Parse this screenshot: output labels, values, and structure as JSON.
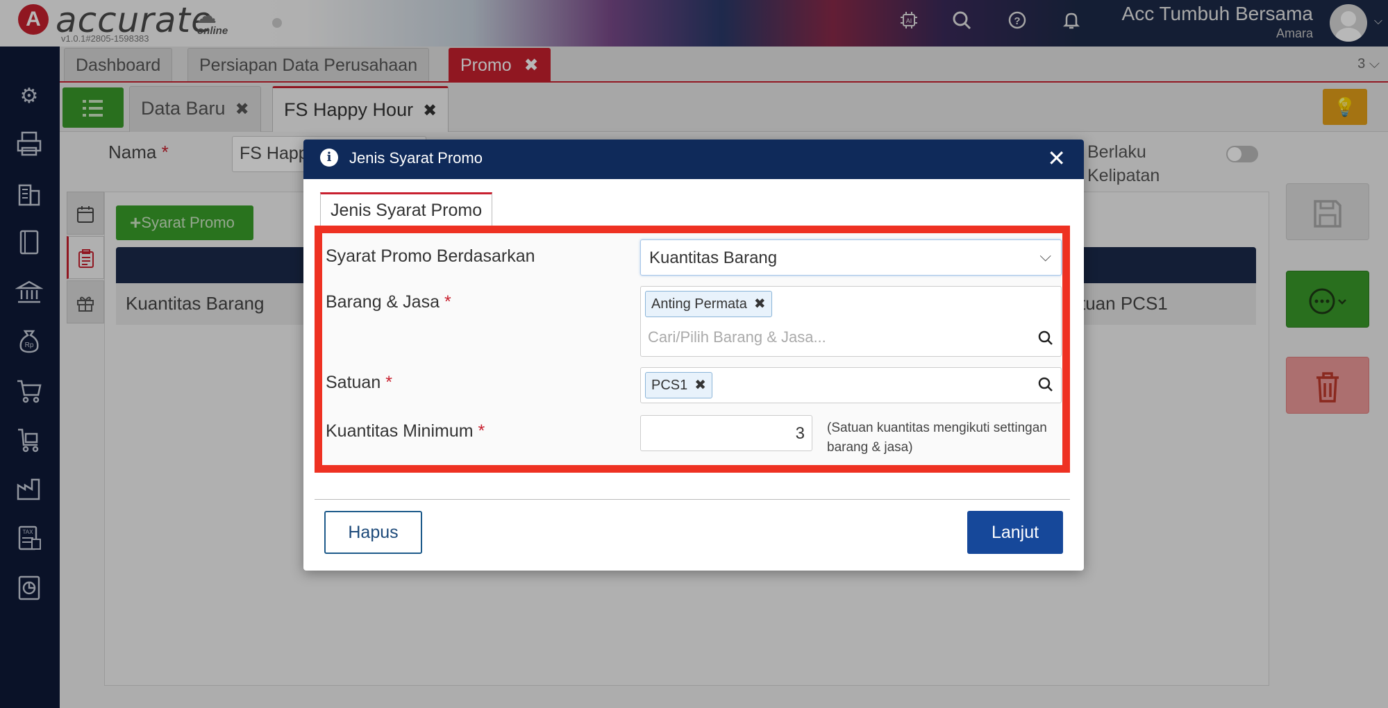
{
  "app": {
    "logo_letter": "A",
    "logo_text": "accurate",
    "logo_sub": "online",
    "version": "v1.0.1#2805-1598383",
    "company_name": "Acc Tumbuh Bersama",
    "user_name": "Amara"
  },
  "top_icons": [
    "ai-chip-icon",
    "search-icon",
    "help-icon",
    "bell-icon"
  ],
  "sidebar": {
    "icons": [
      "gear-icon",
      "printer-icon",
      "building-icon",
      "book-icon",
      "bank-icon",
      "money-bag-icon",
      "cart-icon",
      "delivery-cart-icon",
      "factory-icon",
      "tax-icon",
      "report-icon"
    ]
  },
  "main_tabs": [
    {
      "label": "Dashboard"
    },
    {
      "label": "Persiapan Data Perusahaan"
    },
    {
      "label": "Promo",
      "close": "✖"
    }
  ],
  "main_tab_count": "3 ⌵",
  "sub_tabs": [
    {
      "label": "Data Baru",
      "close": "✖"
    },
    {
      "label": "FS Happy Hour",
      "close": "✖"
    }
  ],
  "form": {
    "nama_label": "Nama",
    "required_mark": "*",
    "nama_value": "FS Happ",
    "berlaku_label_1": "Berlaku",
    "berlaku_label_2": "Kelipatan"
  },
  "panel": {
    "add_button": "Syarat Promo",
    "row_col1": "Kuantitas Barang",
    "row_col2": "tuan PCS1"
  },
  "modal": {
    "title": "Jenis Syarat Promo",
    "close": "✕",
    "tab": "Jenis Syarat Promo",
    "field_basis_label": "Syarat Promo Berdasarkan",
    "field_basis_value": "Kuantitas Barang",
    "field_items_label": "Barang & Jasa",
    "field_items_chip": "Anting Permata",
    "field_items_placeholder": "Cari/Pilih Barang & Jasa...",
    "field_unit_label": "Satuan",
    "field_unit_chip": "PCS1",
    "field_qty_label": "Kuantitas Minimum",
    "field_qty_value": "3",
    "field_qty_note": "(Satuan kuantitas mengikuti settingan barang & jasa)",
    "chip_close": "✖",
    "btn_delete": "Hapus",
    "btn_next": "Lanjut"
  },
  "colors": {
    "brand_red": "#c8202f",
    "navy": "#0f2a5a",
    "highlight": "#ee3122",
    "green": "#3a9a2a"
  }
}
